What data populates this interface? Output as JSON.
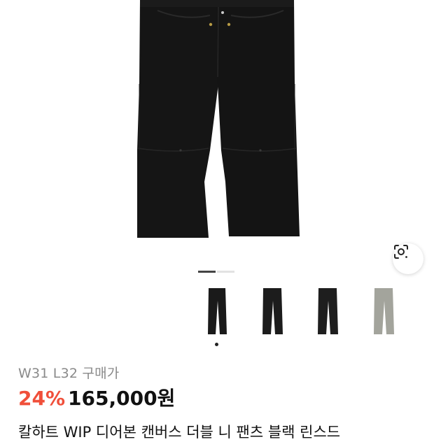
{
  "product": {
    "option_label": "W31 L32 구매가",
    "discount": "24%",
    "price": "165,000원",
    "title": "칼하트 WIP 디어본 캔버스 더블 니 팬츠 블랙 린스드"
  },
  "gallery": {
    "current_index": 1,
    "page_count": 2,
    "lens_icon": "visual-search-icon"
  },
  "thumbnails": [
    {
      "color_name": "black",
      "color": "#1a1a1a",
      "selected": true
    },
    {
      "color_name": "black",
      "color": "#1c1c1c",
      "selected": false
    },
    {
      "color_name": "black",
      "color": "#1e1e1e",
      "selected": false
    },
    {
      "color_name": "grey",
      "color": "#a3a49c",
      "selected": false
    },
    {
      "color_name": "brown",
      "color": "#b7865a",
      "selected": false
    }
  ],
  "colors": {
    "discount": "#f04f3a",
    "price": "#111111",
    "muted": "#8a8a8a"
  }
}
